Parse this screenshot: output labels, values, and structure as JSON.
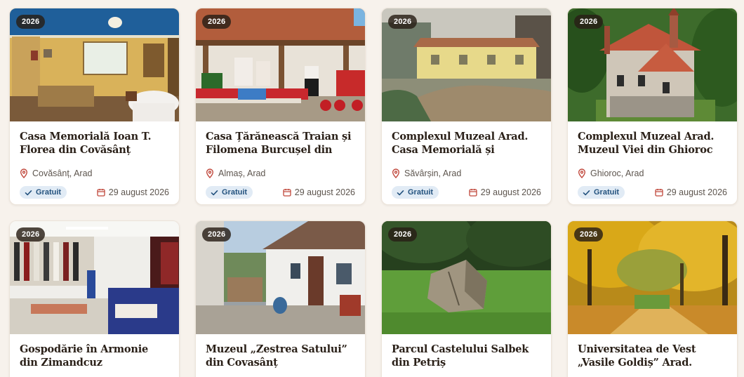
{
  "colors": {
    "accent": "#c0473b",
    "badge_bg": "#e1ebf5",
    "badge_text": "#23527e",
    "page_bg": "#f7f2ec"
  },
  "cards": [
    {
      "year": "2026",
      "title": "Casa Memorială Ioan T. Florea din Covăsânț",
      "location": "Covăsânț, Arad",
      "price": "Gratuit",
      "date": "29 august 2026",
      "image": "memorial-house-interior"
    },
    {
      "year": "2026",
      "title": "Casa Țărănească Traian și Filomena Burcușel din Almaș",
      "location": "Almaș, Arad",
      "price": "Gratuit",
      "date": "29 august 2026",
      "image": "peasant-house-porch"
    },
    {
      "year": "2026",
      "title": "Complexul Muzeal Arad. Casa Memorială și Colecția de art…",
      "location": "Săvârșin, Arad",
      "price": "Gratuit",
      "date": "29 august 2026",
      "image": "painting-yellow-house"
    },
    {
      "year": "2026",
      "title": "Complexul Muzeal Arad. Muzeul Viei din Ghioroc",
      "location": "Ghioroc, Arad",
      "price": "Gratuit",
      "date": "29 august 2026",
      "image": "villa-in-forest"
    },
    {
      "year": "2026",
      "title": "Gospodărie în Armonie din Zimandcuz",
      "image": "classroom-folk-costumes"
    },
    {
      "year": "2026",
      "title": "Muzeul „Zestrea Satului” din Covasânț",
      "image": "village-courtyard"
    },
    {
      "year": "2026",
      "title": "Parcul Castelului Salbek din Petriș",
      "image": "park-stone-sculpture"
    },
    {
      "year": "2026",
      "title": "Universitatea de Vest „Vasile Goldiș” Arad. Grădina…",
      "image": "autumn-garden-path"
    }
  ]
}
